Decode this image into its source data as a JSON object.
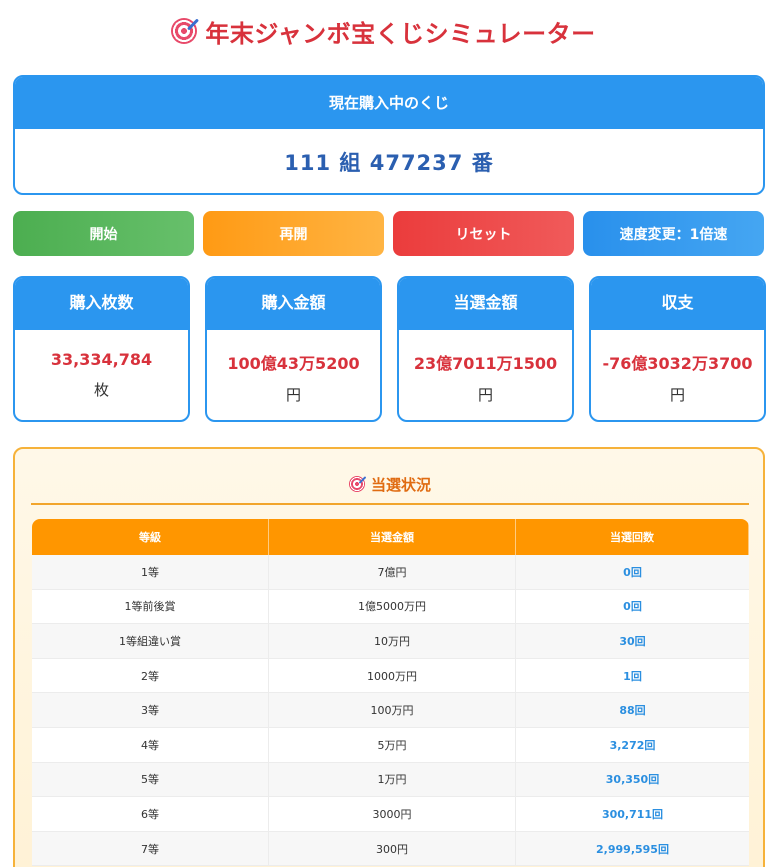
{
  "title": "年末ジャンボ宝くじシミュレーター",
  "current": {
    "header": "現在購入中のくじ",
    "ticket": "111 組 477237 番"
  },
  "buttons": {
    "start": "開始",
    "resume": "再開",
    "reset": "リセット",
    "speed": "速度変更：1倍速"
  },
  "stats": [
    {
      "label": "購入枚数",
      "value": "33,334,784",
      "unit": "枚"
    },
    {
      "label": "購入金額",
      "value": "100億43万5200",
      "unit": "円"
    },
    {
      "label": "当選金額",
      "value": "23億7011万1500",
      "unit": "円"
    },
    {
      "label": "収支",
      "value": "-76億3032万3700",
      "unit": "円"
    }
  ],
  "status": {
    "title": "当選状況",
    "headers": [
      "等級",
      "当選金額",
      "当選回数"
    ],
    "rows": [
      {
        "grade": "1等",
        "amount": "7億円",
        "count": "0回"
      },
      {
        "grade": "1等前後賞",
        "amount": "1億5000万円",
        "count": "0回"
      },
      {
        "grade": "1等組違い賞",
        "amount": "10万円",
        "count": "30回"
      },
      {
        "grade": "2等",
        "amount": "1000万円",
        "count": "1回"
      },
      {
        "grade": "3等",
        "amount": "100万円",
        "count": "88回"
      },
      {
        "grade": "4等",
        "amount": "5万円",
        "count": "3,272回"
      },
      {
        "grade": "5等",
        "amount": "1万円",
        "count": "30,350回"
      },
      {
        "grade": "6等",
        "amount": "3000円",
        "count": "300,711回"
      },
      {
        "grade": "7等",
        "amount": "300円",
        "count": "2,999,595回"
      }
    ]
  }
}
